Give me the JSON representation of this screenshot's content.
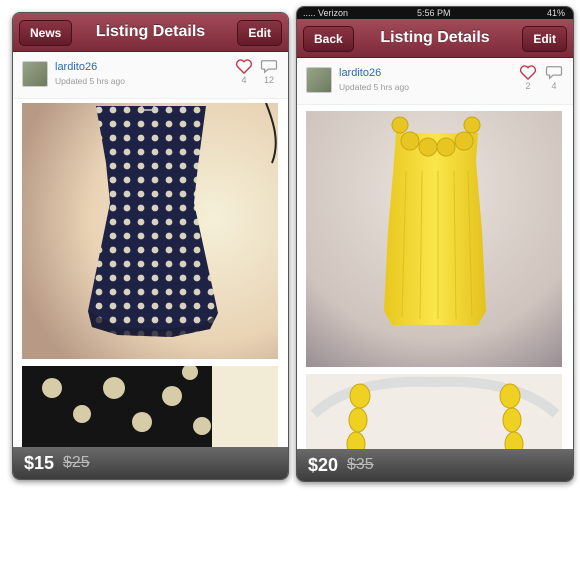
{
  "left": {
    "nav": {
      "back_label": "News",
      "title": "Listing Details",
      "edit_label": "Edit"
    },
    "user": {
      "name": "lardito26",
      "updated": "Updated 5 hrs ago"
    },
    "likes": "4",
    "comments": "12",
    "price": "$15",
    "original_price": "$25"
  },
  "right": {
    "status": {
      "carrier": "..... Verizon",
      "time": "5:56 PM",
      "battery": "41%"
    },
    "nav": {
      "back_label": "Back",
      "title": "Listing Details",
      "edit_label": "Edit"
    },
    "user": {
      "name": "lardito26",
      "updated": "Updated 5 hrs ago"
    },
    "likes": "2",
    "comments": "4",
    "price": "$20",
    "original_price": "$35"
  },
  "colors": {
    "navbar": "#8d3646",
    "link": "#2a6bb0",
    "heart": "#c0394e",
    "dress_navy": "#1e2345",
    "dress_yellow": "#f2dd2e"
  },
  "icons": [
    "heart-icon",
    "comment-icon"
  ]
}
